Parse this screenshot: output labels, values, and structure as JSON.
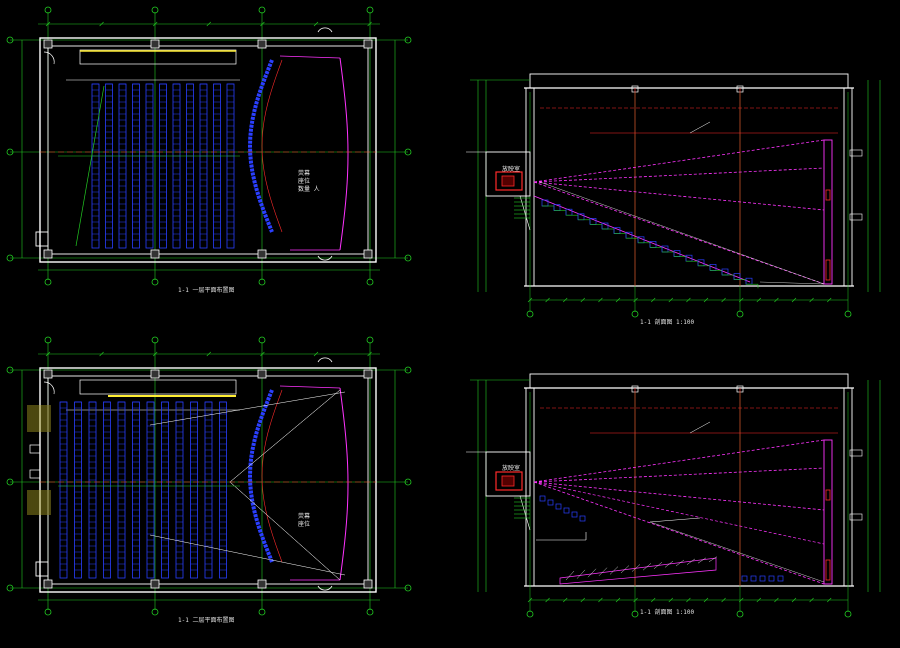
{
  "drawing": {
    "background": "#000000",
    "colors": {
      "wall": "#ffffff",
      "grid": "#22cc22",
      "dim": "#22cc22",
      "seat": "#2a3fff",
      "projection": "#ff33ff",
      "axis_red": "#ff2a2a",
      "screen_yellow": "#ffee33",
      "section": "#ffffff",
      "text": "#e8e8e8"
    },
    "views": {
      "plan_upper": {
        "caption": "1-1 一层平面布置图",
        "room_note_1": "荧幕",
        "room_note_2": "座位",
        "room_note_3": "数量 人"
      },
      "plan_lower": {
        "caption": "1-1 二层平面布置图",
        "room_note_1": "荧幕",
        "room_note_2": "座位"
      },
      "section_upper": {
        "caption": "1-1 剖面图 1:100",
        "booth_label": "放映室"
      },
      "section_lower": {
        "caption": "1-1 剖面图 1:100",
        "booth_label": "放映室"
      }
    }
  }
}
